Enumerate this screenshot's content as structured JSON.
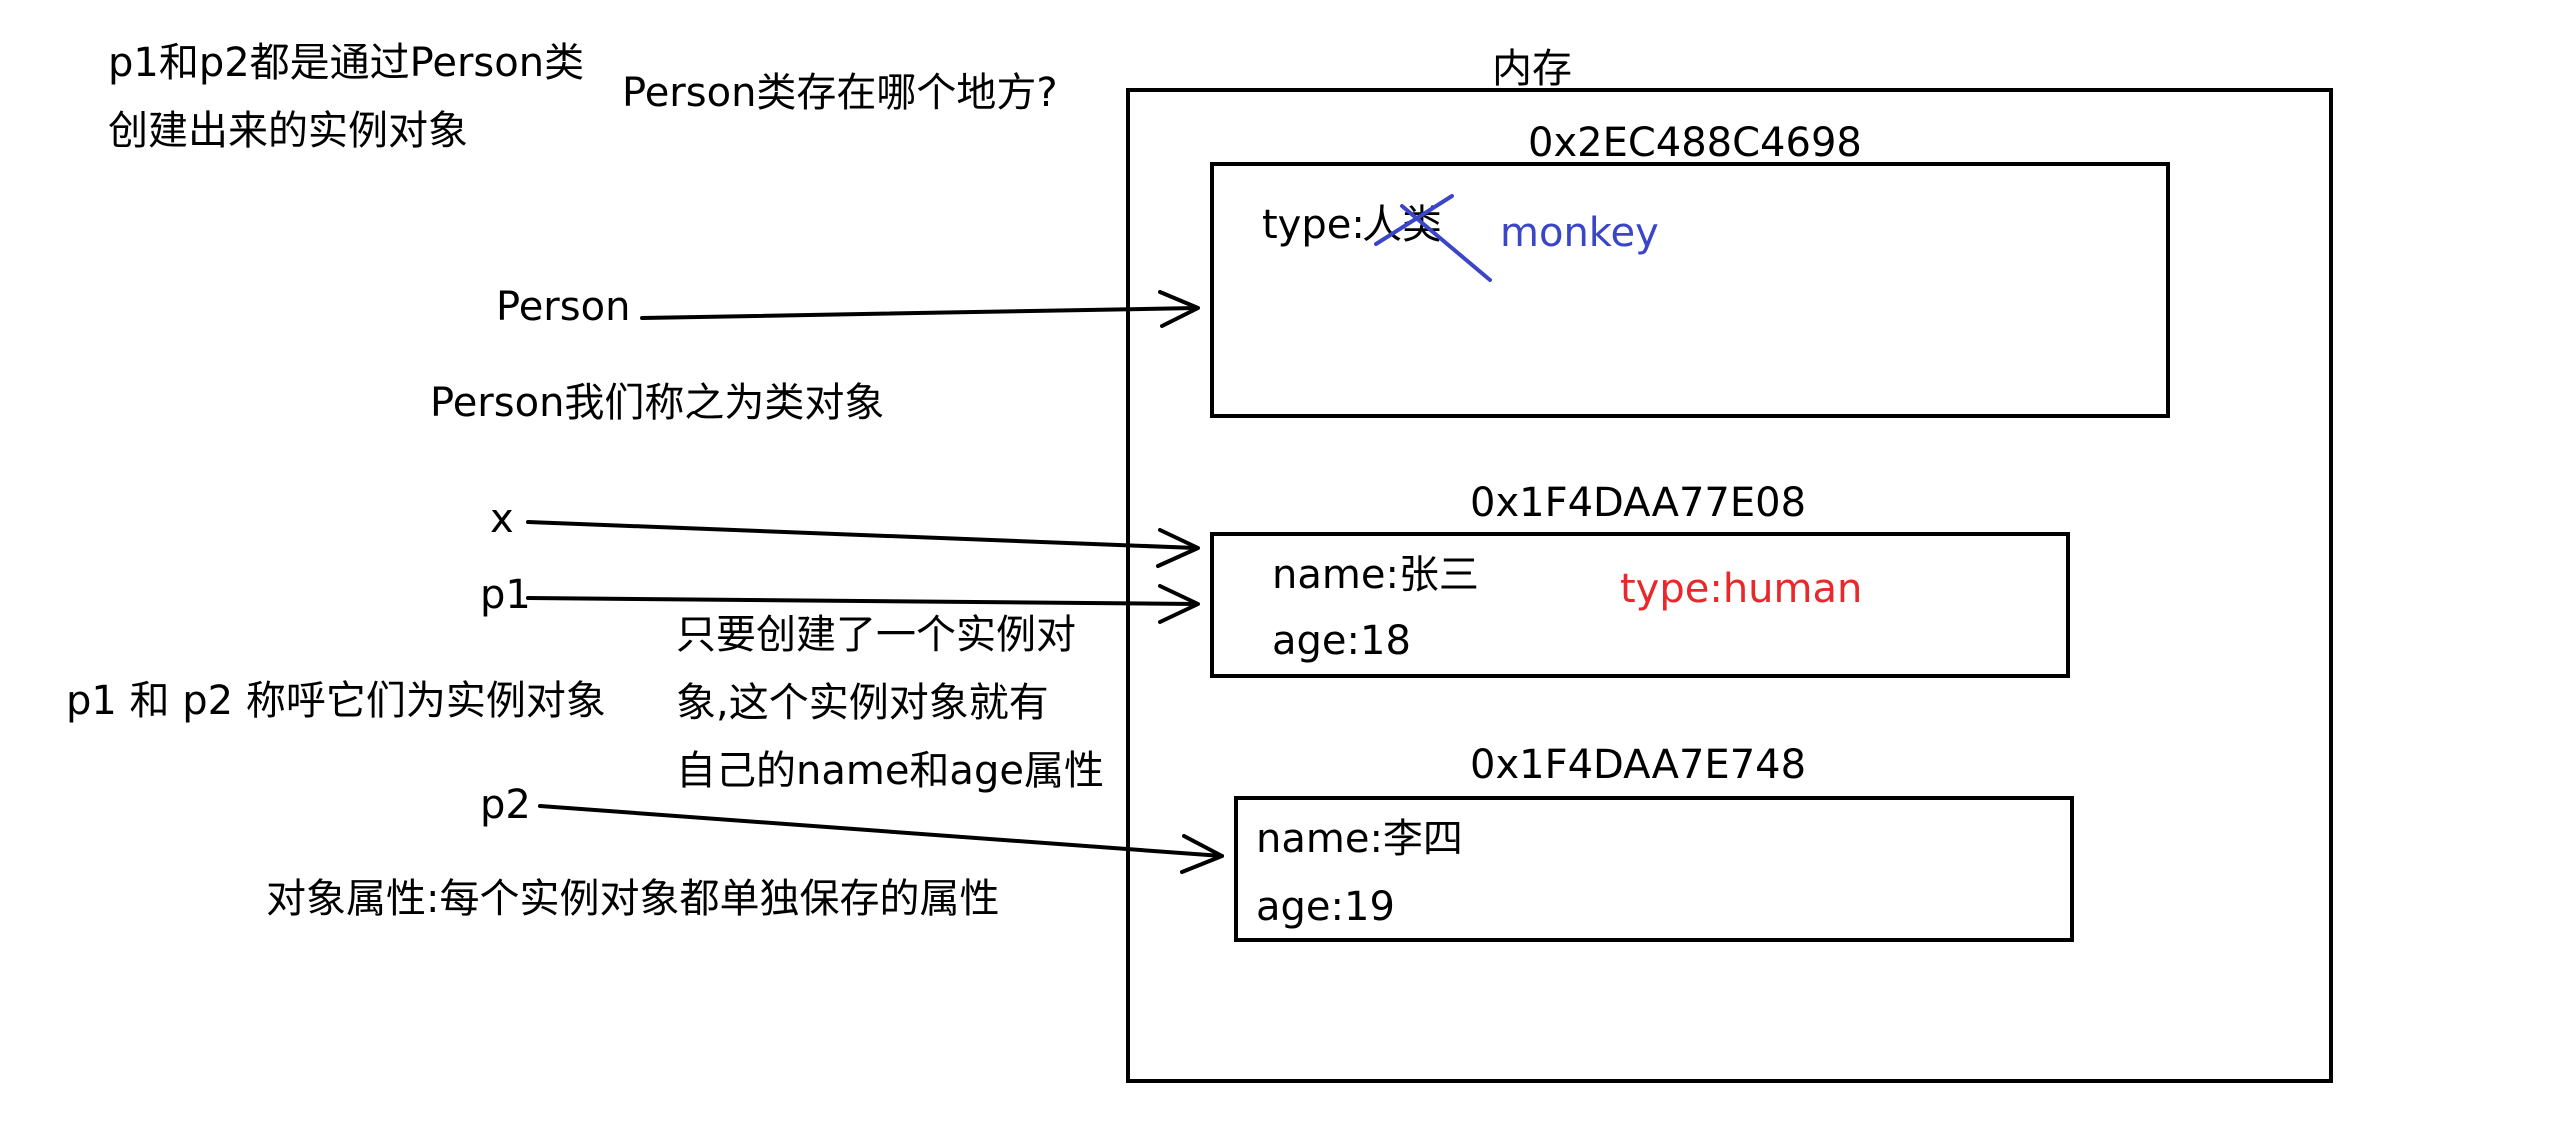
{
  "notes": {
    "instances_line1": "p1和p2都是通过Person类",
    "instances_line2": "创建出来的实例对象",
    "question": "Person类存在哪个地方?",
    "class_object": "Person我们称之为类对象",
    "instance_naming": "p1 和 p2 称呼它们为实例对象",
    "creation_line1": "只要创建了一个实例对",
    "creation_line2": "象,这个实例对象就有",
    "creation_line3": "自己的name和age属性",
    "object_attr": "对象属性:每个实例对象都单独保存的属性"
  },
  "variables": {
    "person": "Person",
    "x": "x",
    "p1": "p1",
    "p2": "p2"
  },
  "memory": {
    "title": "内存",
    "class_block": {
      "address": "0x2EC488C4698",
      "attr_key": "type:",
      "attr_old": "人类",
      "attr_new": "monkey"
    },
    "obj1": {
      "address": "0x1F4DAA77E08",
      "name": "name:张三",
      "age": "age:18",
      "extra": "type:human"
    },
    "obj2": {
      "address": "0x1F4DAA7E748",
      "name": "name:李四",
      "age": "age:19"
    }
  },
  "colors": {
    "blue": "#3a45c8",
    "red": "#e8282a",
    "ink": "#000000"
  }
}
